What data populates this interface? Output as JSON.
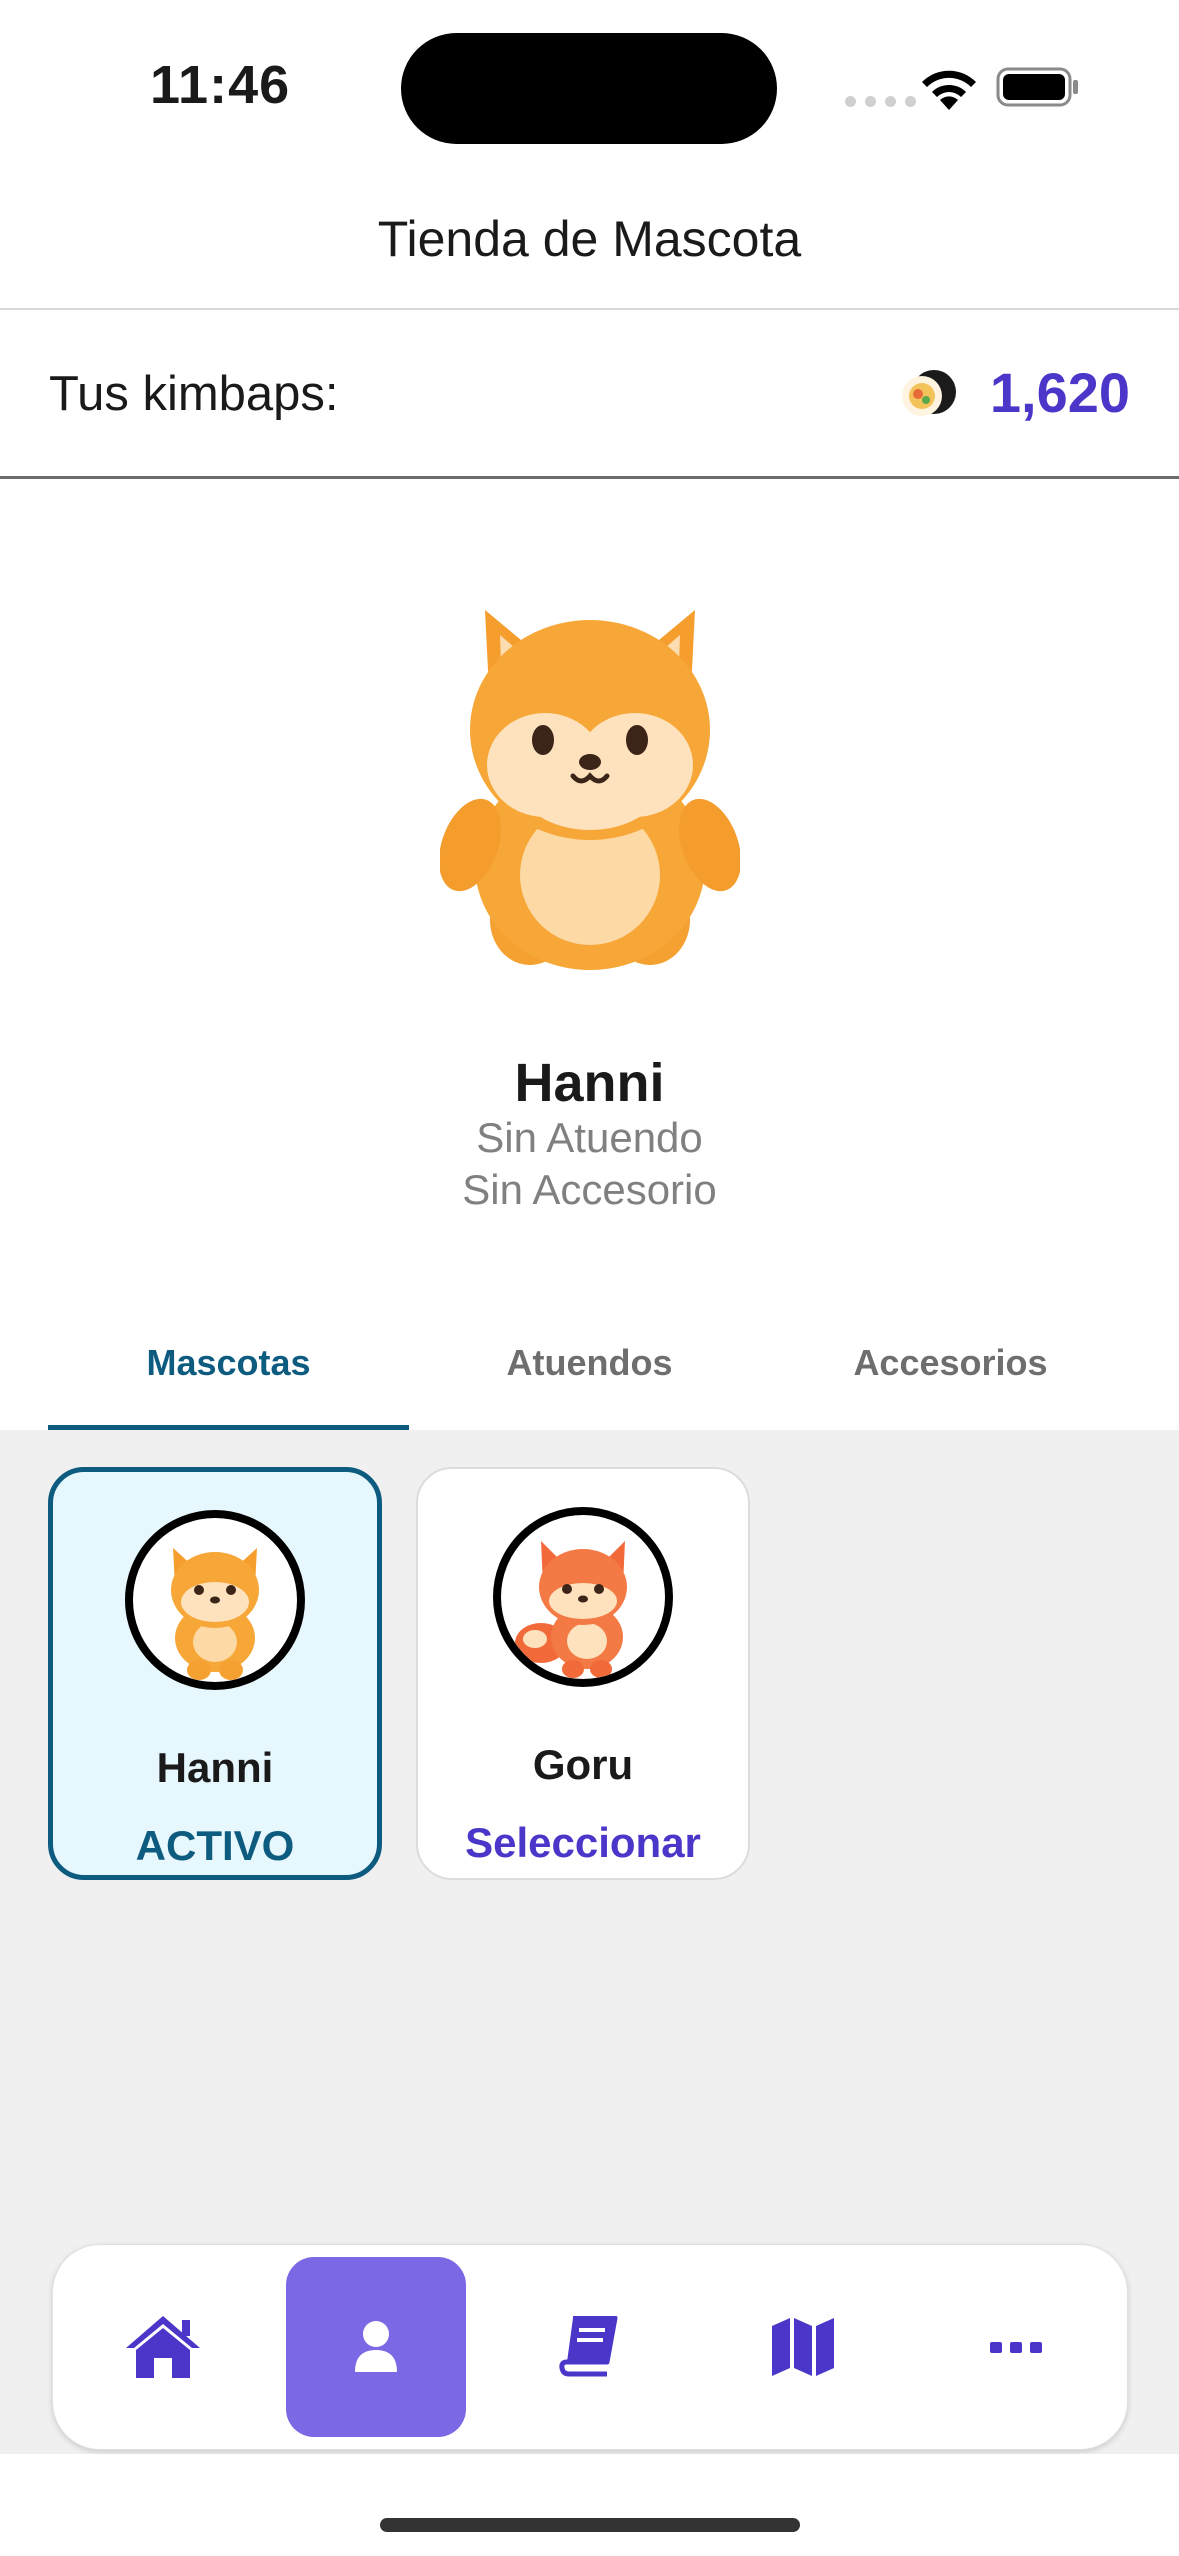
{
  "status": {
    "time": "11:46"
  },
  "header": {
    "title": "Tienda de Mascota"
  },
  "currency": {
    "label": "Tus kimbaps:",
    "count": "1,620"
  },
  "pet": {
    "name": "Hanni",
    "outfit": "Sin Atuendo",
    "accessory": "Sin Accesorio"
  },
  "tabs": [
    {
      "label": "Mascotas",
      "active": true
    },
    {
      "label": "Atuendos",
      "active": false
    },
    {
      "label": "Accesorios",
      "active": false
    }
  ],
  "cards": [
    {
      "name": "Hanni",
      "status": "ACTIVO",
      "active": true
    },
    {
      "name": "Goru",
      "status": "Seleccionar",
      "active": false
    }
  ],
  "tabbar": [
    {
      "icon": "home-icon",
      "active": false
    },
    {
      "icon": "user-icon",
      "active": true
    },
    {
      "icon": "book-icon",
      "active": false
    },
    {
      "icon": "map-icon",
      "active": false
    },
    {
      "icon": "more-icon",
      "active": false
    }
  ],
  "colors": {
    "accent": "#4a37c9",
    "active_tab": "#0e5b80",
    "tab_selected_bg": "#7b68e4"
  }
}
